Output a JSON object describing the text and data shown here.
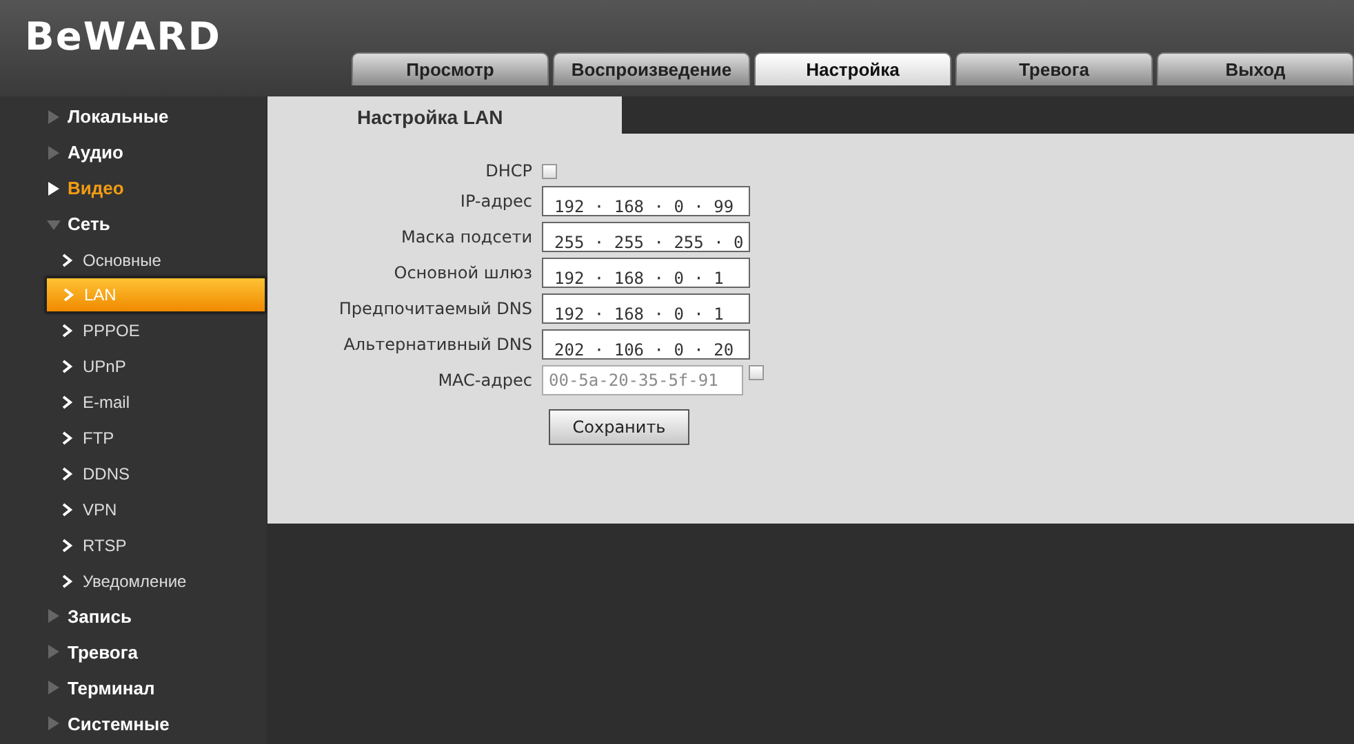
{
  "logo": "BeWARD",
  "tabs": [
    {
      "label": "Просмотр",
      "selected": false
    },
    {
      "label": "Воспроизведение",
      "selected": false
    },
    {
      "label": "Настройка",
      "selected": true
    },
    {
      "label": "Тревога",
      "selected": false
    },
    {
      "label": "Выход",
      "selected": false
    }
  ],
  "sidebar": {
    "items": [
      {
        "label": "Локальные",
        "expanded": false,
        "highlighted": false
      },
      {
        "label": "Аудио",
        "expanded": false,
        "highlighted": false
      },
      {
        "label": "Видео",
        "expanded": false,
        "highlighted": true
      },
      {
        "label": "Сеть",
        "expanded": true,
        "highlighted": false,
        "children": [
          {
            "label": "Основные",
            "selected": false
          },
          {
            "label": "LAN",
            "selected": true
          },
          {
            "label": "PPPOE",
            "selected": false
          },
          {
            "label": "UPnP",
            "selected": false
          },
          {
            "label": "E-mail",
            "selected": false
          },
          {
            "label": "FTP",
            "selected": false
          },
          {
            "label": "DDNS",
            "selected": false
          },
          {
            "label": "VPN",
            "selected": false
          },
          {
            "label": "RTSP",
            "selected": false
          },
          {
            "label": "Уведомление",
            "selected": false
          }
        ]
      },
      {
        "label": "Запись",
        "expanded": false,
        "highlighted": false
      },
      {
        "label": "Тревога",
        "expanded": false,
        "highlighted": false
      },
      {
        "label": "Терминал",
        "expanded": false,
        "highlighted": false
      },
      {
        "label": "Системные",
        "expanded": false,
        "highlighted": false
      }
    ]
  },
  "panel": {
    "title": "Настройка LAN",
    "fields": [
      {
        "kind": "checkbox",
        "label": "DHCP",
        "checked": false
      },
      {
        "kind": "ip",
        "label": "IP-адрес",
        "value": "192 · 168 · 0 · 99"
      },
      {
        "kind": "ip",
        "label": "Маска подсети",
        "value": "255 · 255 · 255 · 0"
      },
      {
        "kind": "ip",
        "label": "Основной шлюз",
        "value": "192 · 168 · 0 · 1"
      },
      {
        "kind": "ip",
        "label": "Предпочитаемый DNS",
        "value": "192 · 168 · 0 · 1"
      },
      {
        "kind": "ip",
        "label": "Альтернативный DNS",
        "value": "202 · 106 · 0 · 20"
      },
      {
        "kind": "mac",
        "label": "MAC-адрес",
        "value": "00-5a-20-35-5f-91",
        "disabled": true,
        "checked": false
      }
    ],
    "save_button": "Сохранить"
  }
}
